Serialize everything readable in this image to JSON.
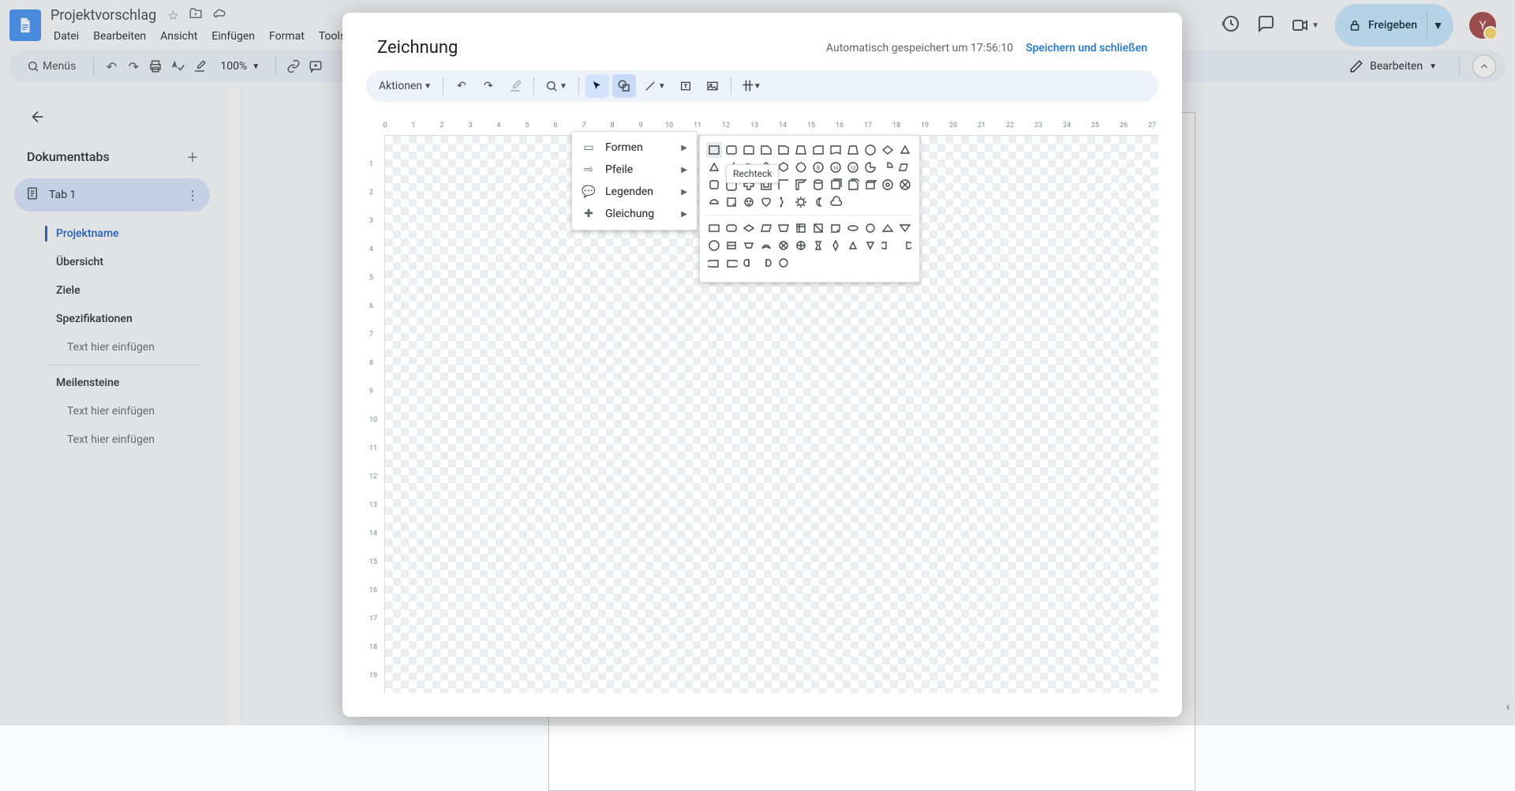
{
  "doc": {
    "title": "Projektvorschlag"
  },
  "menus": {
    "file": "Datei",
    "edit": "Bearbeiten",
    "view": "Ansicht",
    "insert": "Einfügen",
    "format": "Format",
    "tools": "Tools"
  },
  "toolbar": {
    "search": "Menüs",
    "zoom": "100%",
    "mode": "Bearbeiten"
  },
  "share": {
    "label": "Freigeben"
  },
  "avatar": {
    "initial": "Y"
  },
  "sidebar": {
    "heading": "Dokumenttabs",
    "tab": "Tab 1",
    "items": [
      {
        "k": "projektname",
        "label": "Projektname",
        "lvl": "h2",
        "cur": true
      },
      {
        "k": "uebersicht",
        "label": "Übersicht",
        "lvl": "h2"
      },
      {
        "k": "ziele",
        "label": "Ziele",
        "lvl": "h2"
      },
      {
        "k": "spez",
        "label": "Spezifikationen",
        "lvl": "h2"
      },
      {
        "k": "t1",
        "label": "Text hier einfügen",
        "lvl": "h3"
      },
      {
        "k": "meil",
        "label": "Meilensteine",
        "lvl": "h2"
      },
      {
        "k": "t2",
        "label": "Text hier einfügen",
        "lvl": "h3"
      },
      {
        "k": "t3",
        "label": "Text hier einfügen",
        "lvl": "h3"
      }
    ]
  },
  "dialog": {
    "title": "Zeichnung",
    "autosave": "Automatisch gespeichert um 17:56:10",
    "save_close": "Speichern und schließen",
    "actions": "Aktionen"
  },
  "shape_menu": {
    "formen": "Formen",
    "pfeile": "Pfeile",
    "legenden": "Legenden",
    "gleichung": "Gleichung"
  },
  "tooltip": "Rechteck",
  "ruler_h": [
    0,
    1,
    2,
    3,
    4,
    5,
    6,
    7,
    8,
    9,
    10,
    11,
    12,
    13,
    14,
    15,
    16,
    17,
    18,
    19,
    20,
    21,
    22,
    23,
    24,
    25,
    26,
    27
  ],
  "ruler_v": [
    1,
    2,
    3,
    4,
    5,
    6,
    7,
    8,
    9,
    10,
    11,
    12,
    13,
    14,
    15,
    16,
    17,
    18,
    19
  ]
}
